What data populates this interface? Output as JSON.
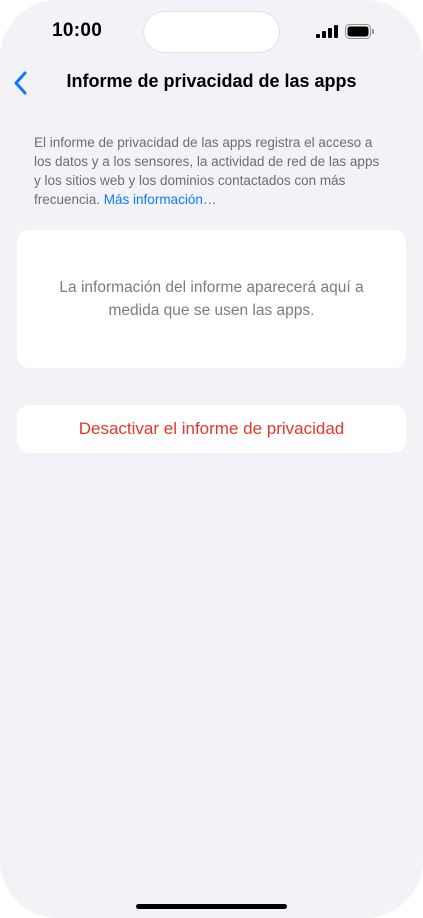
{
  "status_bar": {
    "time": "10:00",
    "signal_icon": "cellular-signal-icon",
    "battery_icon": "battery-icon"
  },
  "nav": {
    "back_icon": "chevron-left-icon",
    "title": "Informe de privacidad de las apps"
  },
  "description": {
    "text": "El informe de privacidad de las apps registra el acceso a los datos y a los sensores, la actividad de red de las apps y los sitios web y los dominios contactados con más frecuencia.",
    "link_label": "Más información…"
  },
  "info_card": {
    "text": "La información del informe aparecerá aquí a medida que se usen las apps."
  },
  "actions": {
    "disable_label": "Desactivar el informe de privacidad"
  },
  "colors": {
    "background": "#f2f2f7",
    "accent": "#0a7aff",
    "destructive": "#e5362d",
    "secondary_text": "#6d6d72"
  }
}
